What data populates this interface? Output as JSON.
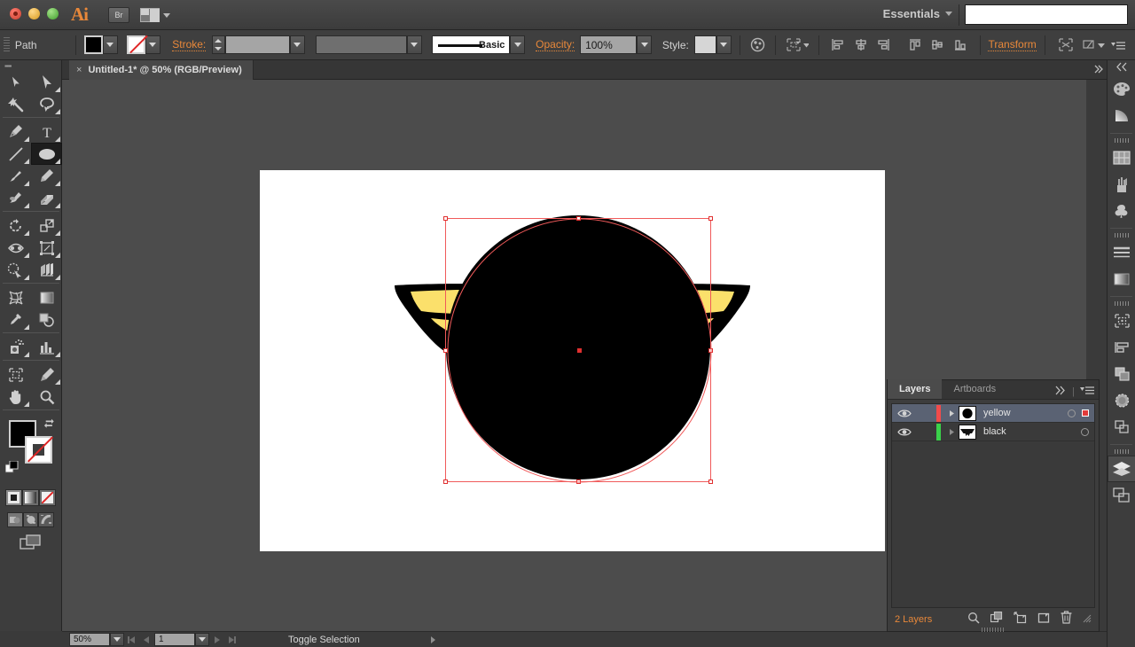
{
  "titlebar": {
    "app_name": "Ai",
    "bridge_label": "Br",
    "arrange_label": "arrange-documents",
    "workspace": "Essentials",
    "search_value": "",
    "search_placeholder": ""
  },
  "controlbar": {
    "object_label": "Path",
    "fill_color": "#000000",
    "stroke_label": "Stroke:",
    "stroke_weight": "",
    "stroke_profile": "",
    "brush_label": "Basic",
    "opacity_label": "Opacity:",
    "opacity_value": "100%",
    "style_label": "Style:",
    "transform_label": "Transform"
  },
  "document": {
    "tab_title": "Untitled-1* @ 50% (RGB/Preview)",
    "close_glyph": "×"
  },
  "statusbar": {
    "zoom_level": "50%",
    "page_number": "1",
    "status_text": "Toggle Selection"
  },
  "layers_panel": {
    "tabs": [
      {
        "label": "Layers",
        "active": true
      },
      {
        "label": "Artboards",
        "active": false
      }
    ],
    "layers": [
      {
        "name": "yellow",
        "color": "#f14b4b",
        "selected": true,
        "has_target": true,
        "thumb": "circle"
      },
      {
        "name": "black",
        "color": "#3ad14a",
        "selected": false,
        "has_target": false,
        "thumb": "wings"
      }
    ],
    "footer_count": "2 Layers",
    "footer_icons": [
      "locate-object-icon",
      "make-clipping-mask-icon",
      "create-new-sublayer-icon",
      "create-new-layer-icon",
      "delete-selection-icon"
    ]
  },
  "toolbar": {
    "tools": [
      "selection-tool",
      "direct-selection-tool",
      "magic-wand-tool",
      "lasso-tool",
      "pen-tool",
      "type-tool",
      "line-segment-tool",
      "ellipse-tool",
      "paintbrush-tool",
      "pencil-tool",
      "blob-brush-tool",
      "eraser-tool",
      "rotate-tool",
      "scale-tool",
      "width-tool",
      "free-transform-tool",
      "shape-builder-tool",
      "perspective-grid-tool",
      "mesh-tool",
      "gradient-tool",
      "eyedropper-tool",
      "blend-tool",
      "symbol-sprayer-tool",
      "column-graph-tool",
      "artboard-tool",
      "slice-tool",
      "hand-tool",
      "zoom-tool"
    ],
    "active_tool": "ellipse-tool",
    "fill_color": "#000000",
    "stroke_color": "none",
    "draw_modes": [
      "draw-normal",
      "draw-behind",
      "draw-inside"
    ],
    "paint_modes": [
      "fill-color",
      "gradient",
      "none"
    ]
  },
  "dock": {
    "icons": [
      "color-panel-icon",
      "color-guide-panel-icon",
      "swatches-panel-icon",
      "brushes-panel-icon",
      "symbols-panel-icon",
      "stroke-panel-icon",
      "gradient-panel-icon",
      "transform-panel-icon",
      "align-panel-icon",
      "pathfinder-panel-icon",
      "transparency-panel-icon",
      "appearance-panel-icon",
      "layers-panel-icon",
      "artboards-panel-icon"
    ],
    "active_icon": "layers-panel-icon"
  },
  "artwork": {
    "description": "black circle over yellow wings",
    "circle_color": "#000000",
    "wing_fill": "#fbe06b",
    "wing_outline": "#000000",
    "artboard_background": "#ffffff",
    "selection_color": "#f05a5a"
  }
}
